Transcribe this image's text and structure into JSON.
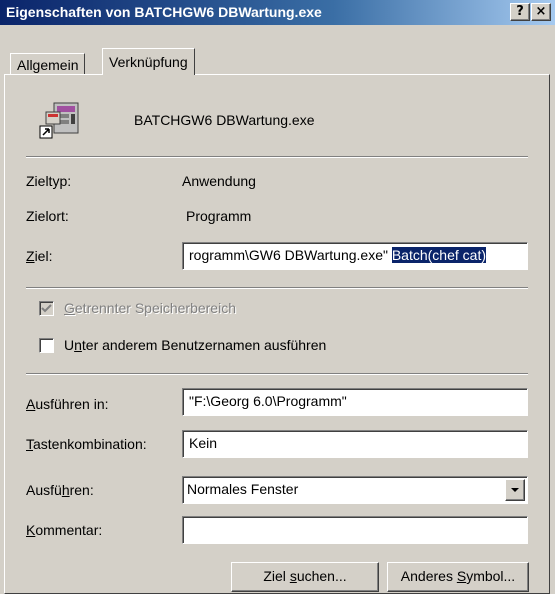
{
  "window": {
    "title": "Eigenschaften von BATCHGW6 DBWartung.exe",
    "help_button": "?",
    "close_button": "×"
  },
  "tabs": [
    {
      "label": "Allgemein",
      "active": false
    },
    {
      "label": "Verknüpfung",
      "active": true
    }
  ],
  "header": {
    "icon": "application-exe-icon",
    "filename": "BATCHGW6 DBWartung.exe"
  },
  "info": {
    "zieltyp_label": "Zieltyp:",
    "zieltyp_value": "Anwendung",
    "zielort_label": "Zielort:",
    "zielort_value": "Programm"
  },
  "ziel": {
    "label_before": "",
    "label_accel": "Z",
    "label_after": "iel:",
    "value_plain": "rogramm\\GW6 DBWartung.exe\" ",
    "value_selected": "Batch(chef cat)"
  },
  "checkboxes": {
    "separate_memory": {
      "label_accel": "G",
      "label_after": "etrennter Speicherbereich",
      "checked": true,
      "disabled": true
    },
    "run_as": {
      "label_before": "U",
      "label_accel": "n",
      "label_after": "ter anderem Benutzernamen ausführen",
      "checked": false
    }
  },
  "fields": {
    "start_in": {
      "label_accel": "A",
      "label_after": "usführen in:",
      "value": "\"F:\\Georg 6.0\\Programm\""
    },
    "shortcut": {
      "label_accel": "T",
      "label_after": "astenkombination:",
      "value": "Kein"
    },
    "run": {
      "label_before": "Ausfü",
      "label_accel": "h",
      "label_after": "ren:",
      "value": "Normales Fenster",
      "dropdown_icon": "chevron-down-icon"
    },
    "comment": {
      "label_accel": "K",
      "label_after": "ommentar:",
      "value": ""
    }
  },
  "buttons": {
    "find_target_before": "Ziel ",
    "find_target_accel": "s",
    "find_target_after": "uchen...",
    "change_icon_before": "Anderes ",
    "change_icon_accel": "S",
    "change_icon_after": "ymbol..."
  }
}
